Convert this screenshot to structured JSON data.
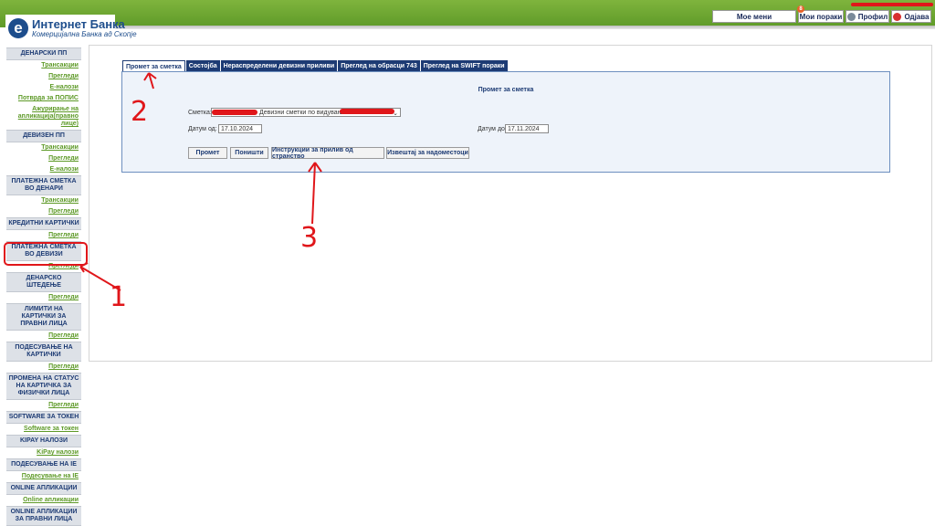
{
  "brand": {
    "title": "Интернет Банка",
    "subtitle": "Комерцијална Банка ад Скопје",
    "logo_letter": "e"
  },
  "topnav": {
    "my_menu": "Мое мени",
    "my_messages": "Мои пораки",
    "messages_count": "8",
    "profile": "Профил",
    "logout": "Одјава"
  },
  "sidebar": {
    "groups": [
      {
        "title": "ДЕНАРСКИ ПП",
        "links": [
          "Трансакции",
          "Прегледи",
          "Е-налози",
          "Потврда за ПОПИС",
          "Ажурирање на апликација(правно лице)"
        ]
      },
      {
        "title": "ДЕВИЗЕН ПП",
        "links": [
          "Трансакции",
          "Прегледи",
          "Е-налози"
        ]
      },
      {
        "title": "ПЛАТЕЖНА СМЕТКА ВО ДЕНАРИ",
        "links": [
          "Трансакции",
          "Прегледи"
        ]
      },
      {
        "title": "КРЕДИТНИ КАРТИЧКИ",
        "links": [
          "Прегледи"
        ]
      },
      {
        "title": "ПЛАТЕЖНА СМЕТКА ВО ДЕВИЗИ",
        "links": [
          "Прегледи"
        ]
      },
      {
        "title": "ДЕНАРСКО ШТЕДЕЊЕ",
        "links": [
          "Прегледи"
        ]
      },
      {
        "title": "ЛИМИТИ НА КАРТИЧКИ ЗА ПРАВНИ ЛИЦА",
        "links": [
          "Прегледи"
        ]
      },
      {
        "title": "ПОДЕСУВАЊЕ НА КАРТИЧКИ",
        "links": [
          "Прегледи"
        ]
      },
      {
        "title": "ПРОМЕНА НА СТАТУС НА КАРТИЧКА ЗА ФИЗИЧКИ ЛИЦА",
        "links": [
          "Прегледи"
        ]
      },
      {
        "title": "SOFTWARE ЗА ТОКЕН",
        "links": [
          "Software за токен"
        ]
      },
      {
        "title": "KIPAY НАЛОЗИ",
        "links": [
          "KiPay налози"
        ]
      },
      {
        "title": "ПОДЕСУВАЊЕ НА IE",
        "links": [
          "Подесување на IE"
        ]
      },
      {
        "title": "ONLINE АПЛИКАЦИИ",
        "links": [
          "Online апликации"
        ]
      },
      {
        "title": "ONLINE АПЛИКАЦИИ ЗА ПРАВНИ ЛИЦА",
        "links": []
      }
    ]
  },
  "tabs": [
    "Промет за сметка",
    "Состојба",
    "Нераспределени девизни приливи",
    "Преглед на обрасци 743",
    "Преглед на SWIFT пораки"
  ],
  "panel": {
    "title": "Промет за сметка",
    "account_label": "Сметка:",
    "account_value": "Девизни сметки по видување",
    "date_from_label": "Датум од:",
    "date_from_value": "17.10.2024",
    "date_to_label": "Датум до:",
    "date_to_value": "17.11.2024",
    "buttons": [
      "Промет",
      "Поништи",
      "Инструкции за прилив од странство",
      "Извештај за надоместоци"
    ]
  },
  "annotations": [
    "1",
    "2",
    "3"
  ],
  "colors": {
    "brand_green": "#5e9a28",
    "navy": "#1d3b74",
    "annotation_red": "#e0161a"
  }
}
